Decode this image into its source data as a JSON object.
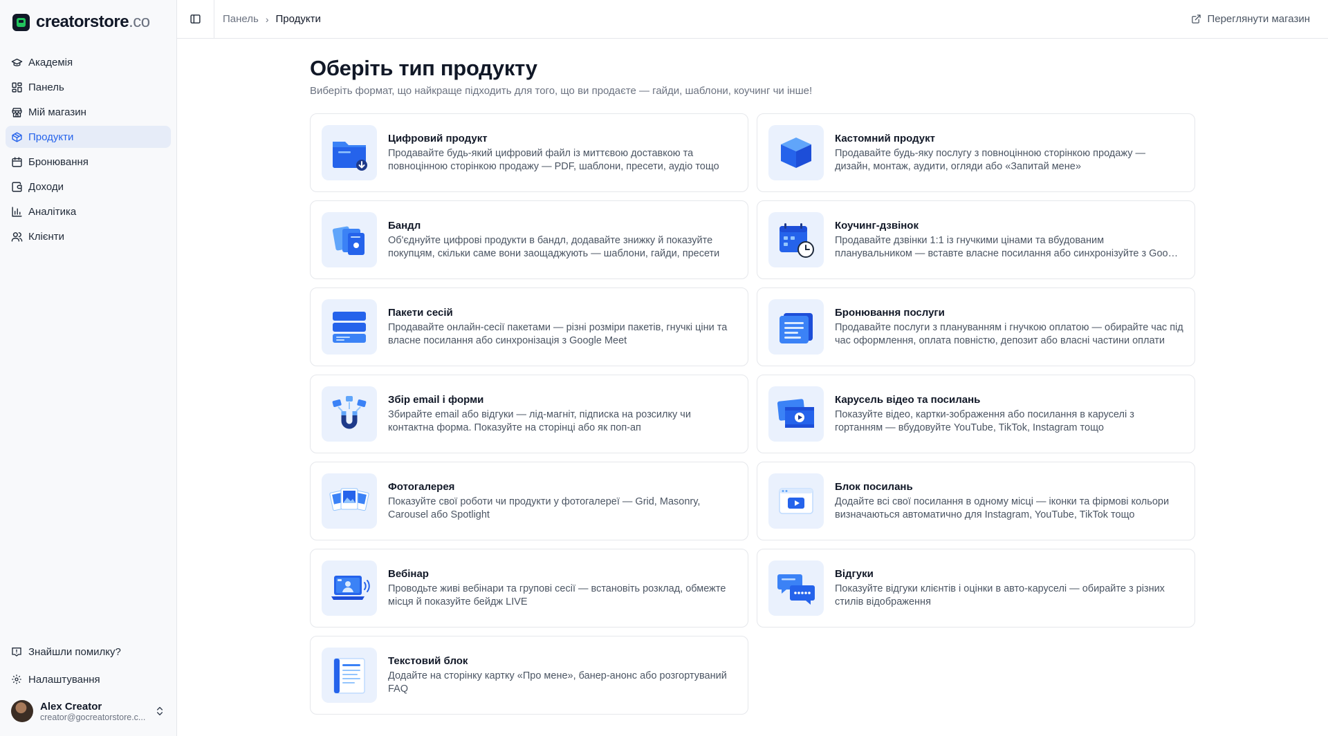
{
  "brand": {
    "name": "creatorstore",
    "tld": ".co"
  },
  "sidebar": {
    "items": [
      {
        "label": "Академія",
        "icon": "graduation-cap-icon"
      },
      {
        "label": "Панель",
        "icon": "dashboard-grid-icon"
      },
      {
        "label": "Мій магазин",
        "icon": "store-icon"
      },
      {
        "label": "Продукти",
        "icon": "box-icon",
        "active": true
      },
      {
        "label": "Бронювання",
        "icon": "calendar-icon"
      },
      {
        "label": "Доходи",
        "icon": "wallet-icon"
      },
      {
        "label": "Аналітика",
        "icon": "bar-chart-icon"
      },
      {
        "label": "Клієнти",
        "icon": "users-icon"
      }
    ],
    "bug_report": "Знайшли помилку?",
    "settings": "Налаштування",
    "user": {
      "name": "Alex Creator",
      "email": "creator@gocreatorstore.c..."
    }
  },
  "topbar": {
    "breadcrumb": {
      "parent": "Панель",
      "current": "Продукти"
    },
    "view_store": "Переглянути магазин"
  },
  "page": {
    "title": "Оберіть тип продукту",
    "subtitle": "Виберіть формат, що найкраще підходить для того, що ви продаєте — гайди, шаблони, коучинг чи інше!"
  },
  "products": [
    {
      "title": "Цифровий продукт",
      "desc": "Продавайте будь-який цифровий файл із миттєвою доставкою та повноцінною сторінкою продажу — PDF, шаблони, пресети, аудіо тощо",
      "icon": "folder-download-icon"
    },
    {
      "title": "Кастомний продукт",
      "desc": "Продавайте будь-яку послугу з повноцінною сторінкою продажу — дизайн, монтаж, аудити, огляди або «Запитай мене»",
      "icon": "cube-icon"
    },
    {
      "title": "Бандл",
      "desc": "Об'єднуйте цифрові продукти в бандл, додавайте знижку й показуйте покупцям, скільки саме вони заощаджують — шаблони, гайди, пресети",
      "icon": "bundle-docs-icon"
    },
    {
      "title": "Коучинг-дзвінок",
      "desc": "Продавайте дзвінки 1:1 із гнучкими цінами та вбудованим планувальником — вставте власне посилання або синхронізуйте з Google Meet",
      "icon": "calendar-clock-icon"
    },
    {
      "title": "Пакети сесій",
      "desc": "Продавайте онлайн-сесії пакетами — різні розміри пакетів, гнучкі ціни та власне посилання або синхронізація з Google Meet",
      "icon": "stacked-sessions-icon"
    },
    {
      "title": "Бронювання послуги",
      "desc": "Продавайте послуги з плануванням і гнучкою оплатою — обирайте час під час оформлення, оплата повністю, депозит або власні частини оплати",
      "icon": "booking-form-icon"
    },
    {
      "title": "Збір email і форми",
      "desc": "Збирайте email або відгуки — лід-магніт, підписка на розсилку чи контактна форма. Показуйте на сторінці або як поп-ап",
      "icon": "magnet-icon"
    },
    {
      "title": "Карусель відео та посилань",
      "desc": "Показуйте відео, картки-зображення або посилання в каруселі з гортанням — вбудовуйте YouTube, TikTok, Instagram тощо",
      "icon": "video-carousel-icon"
    },
    {
      "title": "Фотогалерея",
      "desc": "Показуйте свої роботи чи продукти у фотогалереї — Grid, Masonry, Carousel або Spotlight",
      "icon": "photo-gallery-icon"
    },
    {
      "title": "Блок посилань",
      "desc": "Додайте всі свої посилання в одному місці — іконки та фірмові кольори визначаються автоматично для Instagram, YouTube, TikTok тощо",
      "icon": "link-block-icon"
    },
    {
      "title": "Вебінар",
      "desc": "Проводьте живі вебінари та групові сесії — встановіть розклад, обмежте місця й показуйте бейдж LIVE",
      "icon": "webinar-laptop-icon"
    },
    {
      "title": "Відгуки",
      "desc": "Показуйте відгуки клієнтів і оцінки в авто-каруселі — обирайте з різних стилів відображення",
      "icon": "reviews-chat-icon"
    },
    {
      "title": "Текстовий блок",
      "desc": "Додайте на сторінку картку «Про мене», банер-анонс або розгортуваний FAQ",
      "icon": "text-document-icon"
    }
  ]
}
